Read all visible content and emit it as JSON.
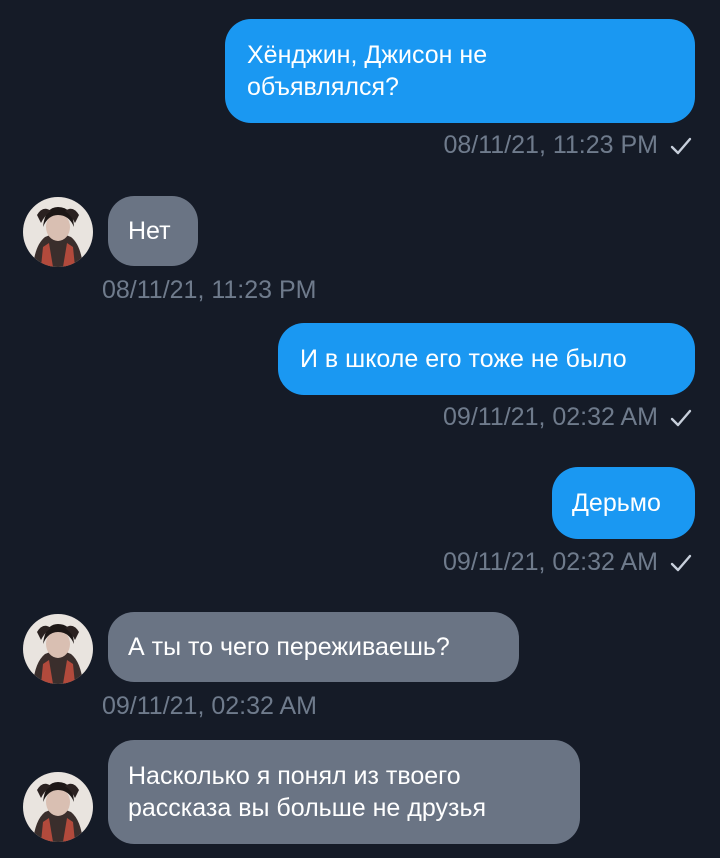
{
  "chat": {
    "colors": {
      "background": "#151b27",
      "outgoing_bubble": "#1a98f2",
      "incoming_bubble": "#6a7484",
      "timestamp": "#6f7b8c"
    },
    "messages": [
      {
        "direction": "outgoing",
        "text": "Хёнджин, Джисон не\nобъявлялся?",
        "timestamp": "08/11/21, 11:23 PM",
        "status_icon": "checkmark-icon"
      },
      {
        "direction": "incoming",
        "text": "Нет",
        "timestamp": "08/11/21, 11:23 PM",
        "avatar_icon": "avatar-photo"
      },
      {
        "direction": "outgoing",
        "text": "И в школе его тоже не было",
        "timestamp": "09/11/21, 02:32 AM",
        "status_icon": "checkmark-icon"
      },
      {
        "direction": "outgoing",
        "text": "Дерьмо",
        "timestamp": "09/11/21, 02:32 AM",
        "status_icon": "checkmark-icon"
      },
      {
        "direction": "incoming",
        "text": "А ты то чего переживаешь?",
        "timestamp": "09/11/21, 02:32 AM",
        "avatar_icon": "avatar-photo"
      },
      {
        "direction": "incoming",
        "text": "Насколько я понял из твоего\nрассказа вы больше не друзья",
        "avatar_icon": "avatar-photo"
      }
    ]
  }
}
